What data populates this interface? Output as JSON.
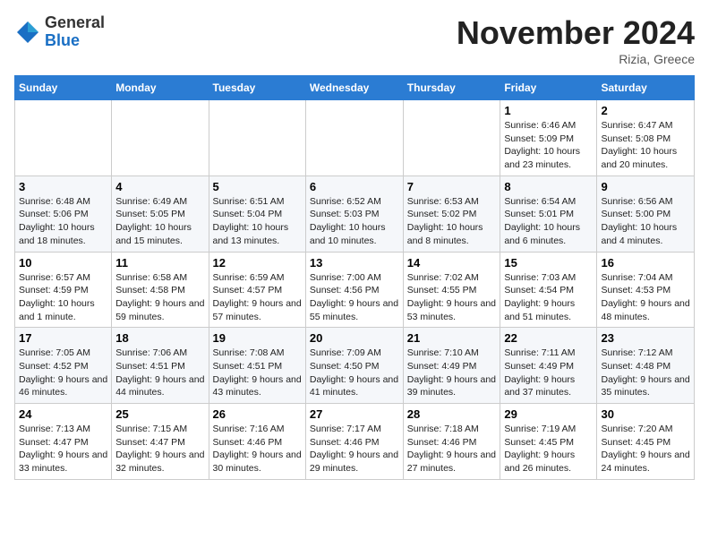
{
  "header": {
    "logo_general": "General",
    "logo_blue": "Blue",
    "month_title": "November 2024",
    "location": "Rizia, Greece"
  },
  "weekdays": [
    "Sunday",
    "Monday",
    "Tuesday",
    "Wednesday",
    "Thursday",
    "Friday",
    "Saturday"
  ],
  "weeks": [
    [
      {
        "day": "",
        "info": ""
      },
      {
        "day": "",
        "info": ""
      },
      {
        "day": "",
        "info": ""
      },
      {
        "day": "",
        "info": ""
      },
      {
        "day": "",
        "info": ""
      },
      {
        "day": "1",
        "info": "Sunrise: 6:46 AM\nSunset: 5:09 PM\nDaylight: 10 hours and 23 minutes."
      },
      {
        "day": "2",
        "info": "Sunrise: 6:47 AM\nSunset: 5:08 PM\nDaylight: 10 hours and 20 minutes."
      }
    ],
    [
      {
        "day": "3",
        "info": "Sunrise: 6:48 AM\nSunset: 5:06 PM\nDaylight: 10 hours and 18 minutes."
      },
      {
        "day": "4",
        "info": "Sunrise: 6:49 AM\nSunset: 5:05 PM\nDaylight: 10 hours and 15 minutes."
      },
      {
        "day": "5",
        "info": "Sunrise: 6:51 AM\nSunset: 5:04 PM\nDaylight: 10 hours and 13 minutes."
      },
      {
        "day": "6",
        "info": "Sunrise: 6:52 AM\nSunset: 5:03 PM\nDaylight: 10 hours and 10 minutes."
      },
      {
        "day": "7",
        "info": "Sunrise: 6:53 AM\nSunset: 5:02 PM\nDaylight: 10 hours and 8 minutes."
      },
      {
        "day": "8",
        "info": "Sunrise: 6:54 AM\nSunset: 5:01 PM\nDaylight: 10 hours and 6 minutes."
      },
      {
        "day": "9",
        "info": "Sunrise: 6:56 AM\nSunset: 5:00 PM\nDaylight: 10 hours and 4 minutes."
      }
    ],
    [
      {
        "day": "10",
        "info": "Sunrise: 6:57 AM\nSunset: 4:59 PM\nDaylight: 10 hours and 1 minute."
      },
      {
        "day": "11",
        "info": "Sunrise: 6:58 AM\nSunset: 4:58 PM\nDaylight: 9 hours and 59 minutes."
      },
      {
        "day": "12",
        "info": "Sunrise: 6:59 AM\nSunset: 4:57 PM\nDaylight: 9 hours and 57 minutes."
      },
      {
        "day": "13",
        "info": "Sunrise: 7:00 AM\nSunset: 4:56 PM\nDaylight: 9 hours and 55 minutes."
      },
      {
        "day": "14",
        "info": "Sunrise: 7:02 AM\nSunset: 4:55 PM\nDaylight: 9 hours and 53 minutes."
      },
      {
        "day": "15",
        "info": "Sunrise: 7:03 AM\nSunset: 4:54 PM\nDaylight: 9 hours and 51 minutes."
      },
      {
        "day": "16",
        "info": "Sunrise: 7:04 AM\nSunset: 4:53 PM\nDaylight: 9 hours and 48 minutes."
      }
    ],
    [
      {
        "day": "17",
        "info": "Sunrise: 7:05 AM\nSunset: 4:52 PM\nDaylight: 9 hours and 46 minutes."
      },
      {
        "day": "18",
        "info": "Sunrise: 7:06 AM\nSunset: 4:51 PM\nDaylight: 9 hours and 44 minutes."
      },
      {
        "day": "19",
        "info": "Sunrise: 7:08 AM\nSunset: 4:51 PM\nDaylight: 9 hours and 43 minutes."
      },
      {
        "day": "20",
        "info": "Sunrise: 7:09 AM\nSunset: 4:50 PM\nDaylight: 9 hours and 41 minutes."
      },
      {
        "day": "21",
        "info": "Sunrise: 7:10 AM\nSunset: 4:49 PM\nDaylight: 9 hours and 39 minutes."
      },
      {
        "day": "22",
        "info": "Sunrise: 7:11 AM\nSunset: 4:49 PM\nDaylight: 9 hours and 37 minutes."
      },
      {
        "day": "23",
        "info": "Sunrise: 7:12 AM\nSunset: 4:48 PM\nDaylight: 9 hours and 35 minutes."
      }
    ],
    [
      {
        "day": "24",
        "info": "Sunrise: 7:13 AM\nSunset: 4:47 PM\nDaylight: 9 hours and 33 minutes."
      },
      {
        "day": "25",
        "info": "Sunrise: 7:15 AM\nSunset: 4:47 PM\nDaylight: 9 hours and 32 minutes."
      },
      {
        "day": "26",
        "info": "Sunrise: 7:16 AM\nSunset: 4:46 PM\nDaylight: 9 hours and 30 minutes."
      },
      {
        "day": "27",
        "info": "Sunrise: 7:17 AM\nSunset: 4:46 PM\nDaylight: 9 hours and 29 minutes."
      },
      {
        "day": "28",
        "info": "Sunrise: 7:18 AM\nSunset: 4:46 PM\nDaylight: 9 hours and 27 minutes."
      },
      {
        "day": "29",
        "info": "Sunrise: 7:19 AM\nSunset: 4:45 PM\nDaylight: 9 hours and 26 minutes."
      },
      {
        "day": "30",
        "info": "Sunrise: 7:20 AM\nSunset: 4:45 PM\nDaylight: 9 hours and 24 minutes."
      }
    ]
  ]
}
